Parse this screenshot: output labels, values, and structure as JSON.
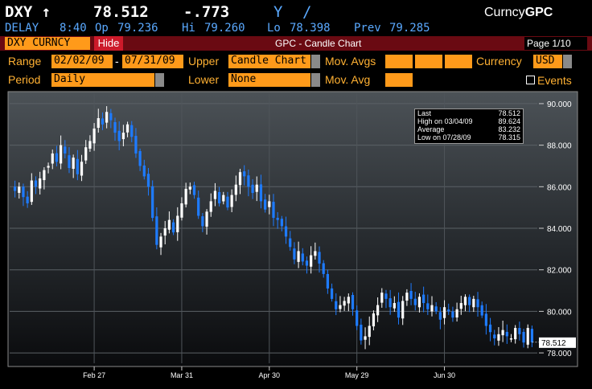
{
  "header": {
    "ticker": "DXY",
    "arrow": "↑",
    "last": "78.512",
    "change": "-.773",
    "y_label": "Y",
    "slash": "/",
    "func_prefix": "Curncy",
    "func_name": "GPC",
    "delay": "DELAY",
    "time": "8:40",
    "open_label": "Op",
    "open": "79.236",
    "hi_label": "Hi",
    "hi": "79.260",
    "lo_label": "Lo",
    "lo": "78.398",
    "prev_label": "Prev",
    "prev": "79.285"
  },
  "toolbar": {
    "security": "DXY CURNCY",
    "hide": "Hide",
    "title": "GPC - Candle Chart",
    "page": "Page 1/10"
  },
  "controls": {
    "range_label": "Range",
    "range_start": "02/02/09",
    "range_dash": "-",
    "range_end": "07/31/09",
    "upper_label": "Upper",
    "upper_value": "Candle Chart",
    "mov_avgs_label": "Mov. Avgs",
    "currency_label": "Currency",
    "currency_value": "USD",
    "period_label": "Period",
    "period_value": "Daily",
    "lower_label": "Lower",
    "lower_value": "None",
    "mov_avg_label": "Mov. Avg",
    "events_label": "Events"
  },
  "legend": [
    {
      "label": "Last",
      "value": "78.512"
    },
    {
      "label": "High on  03/04/09",
      "value": "89.624"
    },
    {
      "label": "Average",
      "value": "83.232"
    },
    {
      "label": "Low on  07/28/09",
      "value": "78.315"
    }
  ],
  "colors": {
    "accent": "#ff9a1a",
    "bar": "#6a0a12",
    "up": "#ffffff",
    "down": "#1e7bff",
    "label": "#ffb133"
  },
  "chart_data": {
    "type": "candlestick",
    "xlabels": [
      "Feb 27",
      "Mar 31",
      "Apr 30",
      "May 29",
      "Jun 30"
    ],
    "ylabels": [
      "90.000",
      "88.000",
      "86.000",
      "84.000",
      "82.000",
      "80.000",
      "78.000"
    ],
    "ylim": [
      77.5,
      90.5
    ],
    "last_label": "78.512",
    "last": 78.512,
    "grid": true,
    "close_path": [
      85.8,
      86.0,
      85.5,
      85.2,
      86.3,
      86.0,
      86.4,
      86.8,
      87.0,
      87.6,
      87.2,
      88.0,
      87.6,
      86.9,
      87.4,
      86.6,
      87.2,
      87.9,
      88.2,
      88.8,
      89.3,
      89.0,
      89.6,
      89.2,
      88.6,
      88.2,
      88.6,
      89.0,
      88.4,
      87.6,
      87.0,
      86.5,
      86.0,
      84.5,
      83.2,
      83.6,
      84.0,
      84.4,
      83.8,
      84.6,
      85.2,
      85.9,
      86.0,
      85.6,
      84.6,
      84.1,
      84.8,
      85.3,
      85.8,
      85.2,
      85.6,
      85.0,
      85.6,
      86.1,
      86.7,
      86.5,
      86.0,
      85.7,
      86.1,
      85.3,
      84.9,
      85.3,
      84.5,
      84.4,
      84.1,
      83.6,
      83.1,
      82.5,
      82.9,
      82.4,
      82.2,
      82.7,
      82.9,
      82.3,
      81.8,
      81.1,
      80.6,
      80.1,
      80.3,
      80.5,
      80.7,
      80.1,
      79.3,
      78.6,
      78.8,
      79.3,
      79.9,
      80.3,
      80.9,
      80.6,
      80.2,
      80.4,
      79.7,
      80.5,
      80.9,
      80.6,
      80.3,
      80.7,
      80.4,
      80.1,
      80.3,
      80.0,
      79.6,
      80.2,
      80.0,
      79.7,
      80.1,
      80.4,
      80.7,
      80.3,
      80.6,
      80.2,
      79.8,
      79.3,
      79.0,
      78.7,
      78.9,
      79.1,
      78.8,
      78.7,
      79.2,
      78.9,
      78.5,
      79.2,
      78.512
    ]
  }
}
